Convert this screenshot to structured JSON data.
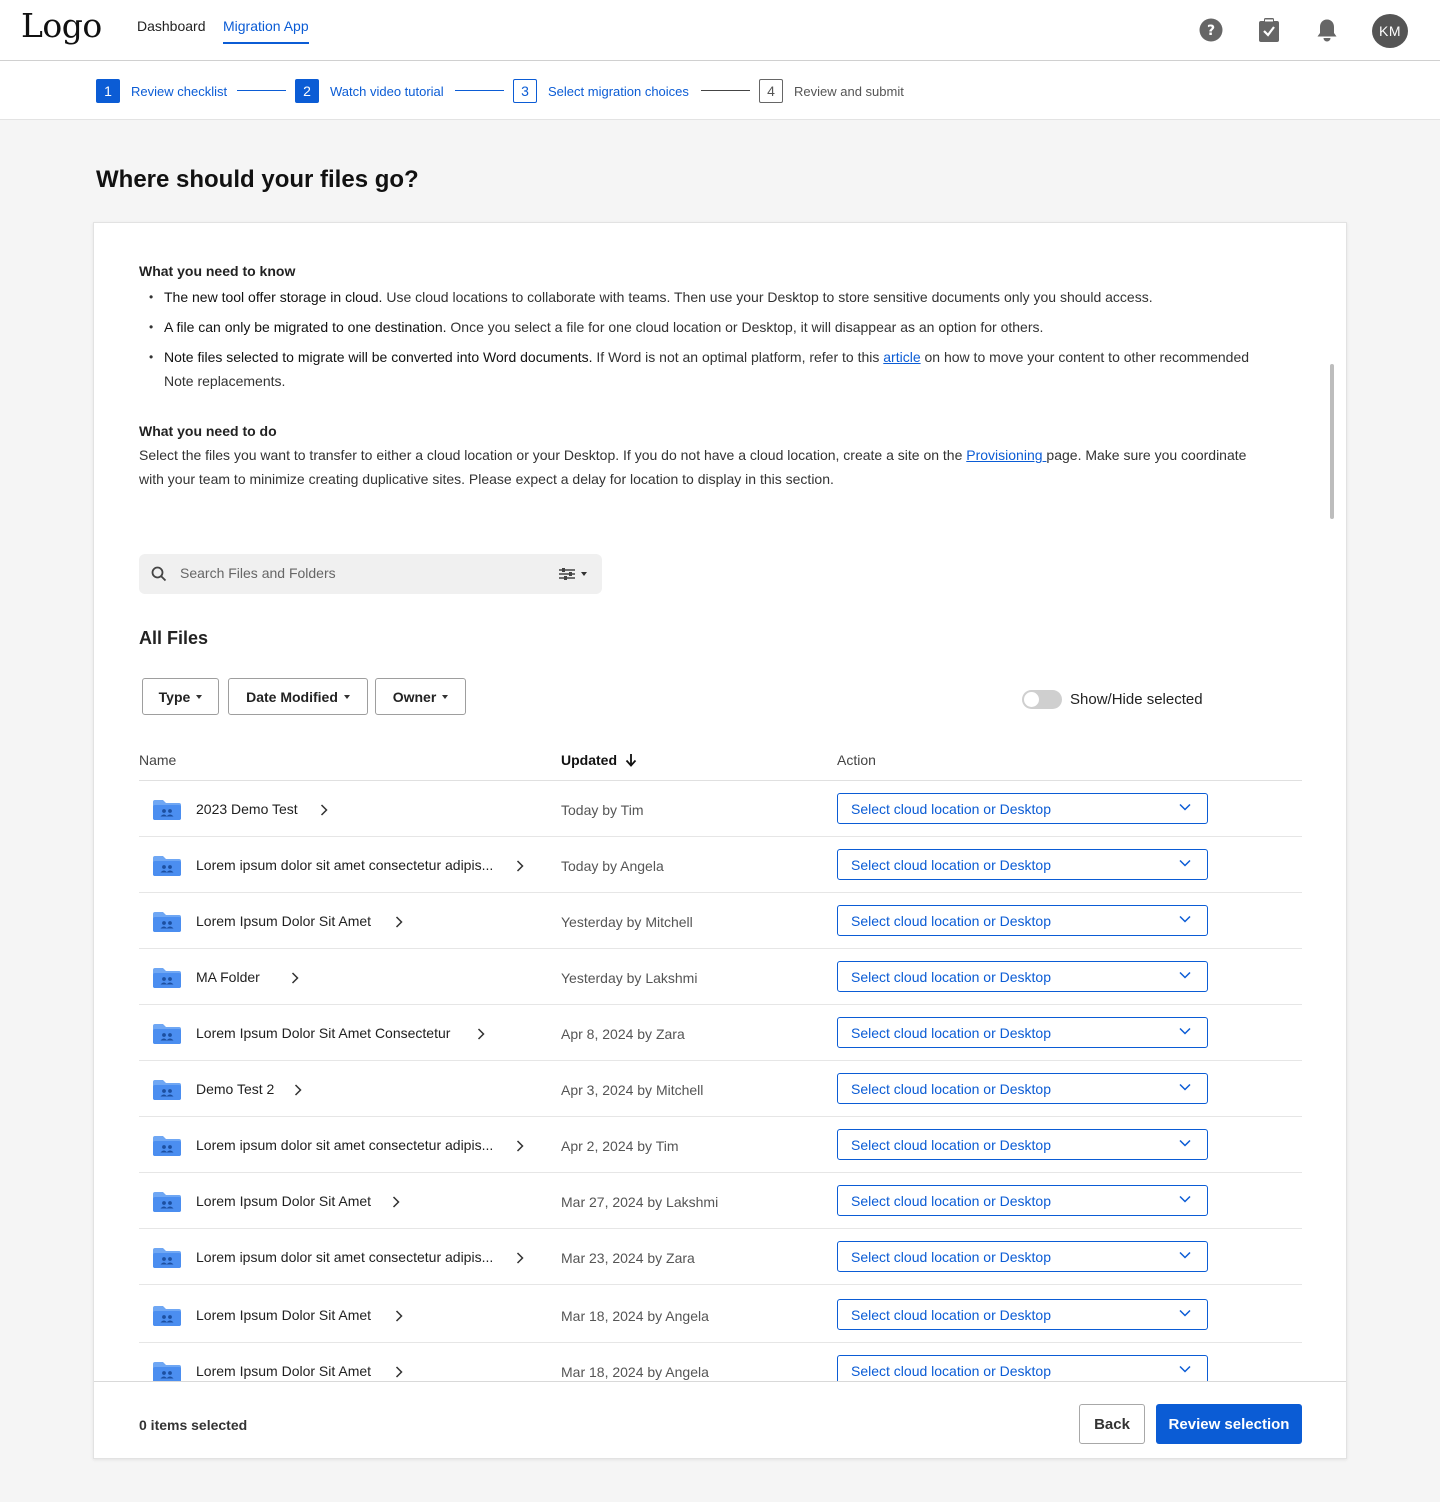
{
  "nav": {
    "logo": "Logo",
    "tabs": [
      {
        "label": "Dashboard"
      },
      {
        "label": "Migration App"
      }
    ],
    "avatar_initials": "KM",
    "icon_names": [
      "help-icon",
      "clipboard-check-icon",
      "bell-icon"
    ],
    "accent_color": "#0b5cd5"
  },
  "stepper": {
    "steps": [
      {
        "num": "1",
        "label": "Review checklist",
        "state": "complete"
      },
      {
        "num": "2",
        "label": "Watch video tutorial",
        "state": "complete"
      },
      {
        "num": "3",
        "label": "Select migration choices",
        "state": "current"
      },
      {
        "num": "4",
        "label": "Review and submit",
        "state": "upcoming"
      }
    ]
  },
  "page": {
    "title": "Where should your files go?"
  },
  "know": {
    "heading": "What you need to know",
    "b1_bold": "The new tool offer storage in cloud.",
    "b1_text": " Use cloud locations to collaborate with teams. Then use your Desktop to store sensitive documents only you should access.",
    "b2_bold": "A file can only be migrated to one destination.",
    "b2_text": " Once you select a file for one cloud location or Desktop, it will disappear as an option for others.",
    "b3_bold": "Note files selected to migrate will be converted into Word documents.",
    "b3_text_a": " If Word is not an optimal platform, refer to this ",
    "b3_link": "article",
    "b3_text_b": " on how to move your content to other recommended Note replacements."
  },
  "todo": {
    "heading": "What you need to do",
    "text_a": "Select the files you want to transfer to either a cloud location or your Desktop. If you do not have a cloud location, create a site on the ",
    "link": "Provisioning ",
    "text_b": "page. Make sure you coordinate with your team to minimize creating duplicative sites. Please expect a delay for location to display in this section."
  },
  "search": {
    "placeholder": "Search Files and Folders",
    "value": ""
  },
  "files": {
    "heading": "All Files",
    "filters": [
      {
        "label": "Type"
      },
      {
        "label": "Date Modified"
      },
      {
        "label": "Owner"
      }
    ],
    "toggle_label": "Show/Hide selected",
    "toggle_on": false,
    "columns": {
      "name": "Name",
      "updated": "Updated",
      "action": "Action"
    },
    "action_label": "Select cloud location or Desktop",
    "rows": [
      {
        "name": "2023 Demo Test",
        "updated": "Today by Tim"
      },
      {
        "name": "Lorem ipsum dolor sit amet consectetur adipis...",
        "updated": "Today by Angela"
      },
      {
        "name": "Lorem Ipsum Dolor Sit Amet",
        "updated": "Yesterday by Mitchell"
      },
      {
        "name": "MA Folder",
        "updated": "Yesterday by Lakshmi"
      },
      {
        "name": "Lorem Ipsum Dolor Sit Amet Consectetur",
        "updated": "Apr 8, 2024 by Zara"
      },
      {
        "name": "Demo Test 2",
        "updated": "Apr 3, 2024 by Mitchell"
      },
      {
        "name": "Lorem ipsum dolor sit amet consectetur adipis...",
        "updated": "Apr 2, 2024 by Tim"
      },
      {
        "name": "Lorem Ipsum Dolor Sit Amet",
        "updated": "Mar 27, 2024 by Lakshmi"
      },
      {
        "name": "Lorem ipsum dolor sit amet consectetur adipis...",
        "updated": "Mar 23, 2024 by Zara"
      },
      {
        "name": "Lorem Ipsum Dolor Sit Amet",
        "updated": "Mar 18, 2024 by Angela"
      },
      {
        "name": "Lorem Ipsum Dolor Sit Amet",
        "updated": "Mar 18, 2024 by Angela"
      }
    ]
  },
  "footer": {
    "selected_count": "0 items selected",
    "back_label": "Back",
    "review_label": "Review selection"
  }
}
